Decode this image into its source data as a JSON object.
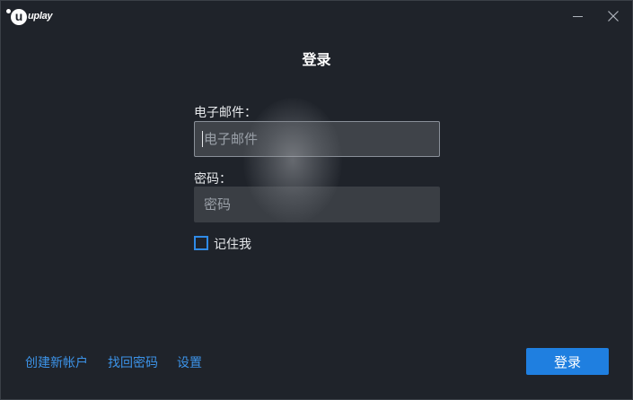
{
  "app": {
    "logo_text": "uplay",
    "logo_letter": "u"
  },
  "window_controls": {
    "minimize_icon": "minimize-icon",
    "close_icon": "close-icon"
  },
  "dialog": {
    "title": "登录",
    "email": {
      "label": "电子邮件：",
      "placeholder": "电子邮件",
      "value": ""
    },
    "password": {
      "label": "密码：",
      "placeholder": "密码",
      "value": ""
    },
    "remember": {
      "label": "记住我",
      "checked": false
    },
    "login_button": "登录"
  },
  "footer": {
    "create_account": "创建新帐户",
    "recover_password": "找回密码",
    "settings": "设置"
  },
  "colors": {
    "background": "#1f232a",
    "accent": "#1f7fe0",
    "link": "#3c93e8",
    "field_bg": "#3a3e44"
  }
}
